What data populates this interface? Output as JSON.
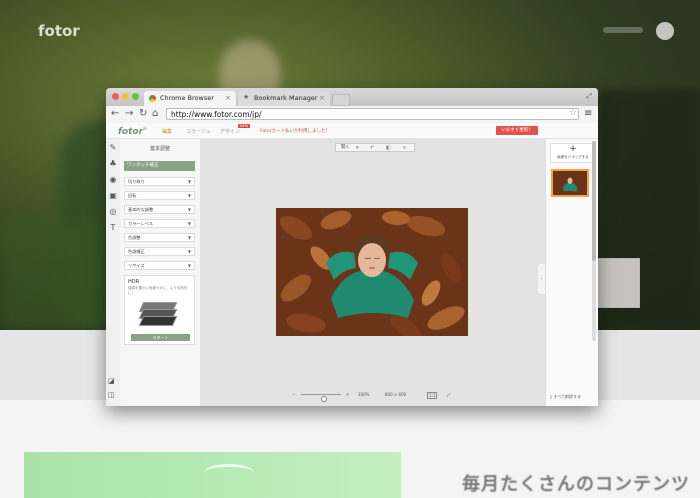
{
  "background_site": {
    "logo": "fotor",
    "heading": "毎月たくさんのコンテンツ"
  },
  "browser": {
    "tabs": [
      {
        "label": "Chrome Browser",
        "active": true
      },
      {
        "label": "Bookmark Manager",
        "active": false
      }
    ],
    "address": "http://www.fotor.com/jp/",
    "colors": {
      "close": "#f25d57",
      "minimize": "#f5bf2f",
      "zoom": "#5fc43f"
    }
  },
  "app": {
    "logo": "fotor",
    "logo_mark": "®",
    "nav": [
      {
        "label": "編集",
        "active": true
      },
      {
        "label": "コラージュ",
        "active": false
      },
      {
        "label": "デザイン",
        "active": false
      }
    ],
    "nav_new_badge": "NEW",
    "notice": "Fotorカード払いが利用しました！",
    "cta": "いますぐ更新！",
    "accent": "#8ba288",
    "cta_color": "#e4534b"
  },
  "tools": [
    "brush-icon",
    "sticker-icon",
    "eye-icon",
    "frame-icon",
    "circle-icon",
    "text-icon"
  ],
  "panel": {
    "title": "基本調整",
    "one_click": "ワンタッチ補正",
    "options": [
      "切り取り",
      "回転",
      "基本的な調整",
      "カラーレベル",
      "色調整",
      "色調補正",
      "リサイズ"
    ],
    "hdr": {
      "title": "HDR",
      "desc": "階調を豊かに色鮮やかに、より自然的に！",
      "start": "スタート"
    }
  },
  "canvas": {
    "top_menu": "開く",
    "zoom_percent": "100%",
    "dimensions": "800 × 600",
    "ratio": "1:1"
  },
  "right_panel": {
    "add_label": "画像をドラッグする",
    "clear_label": "すべて削除する"
  }
}
